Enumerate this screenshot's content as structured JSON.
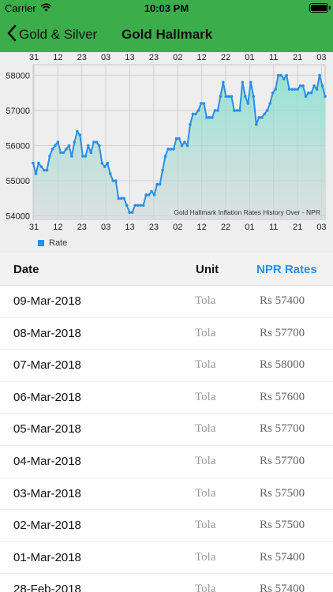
{
  "status": {
    "carrier": "Carrier",
    "time": "10:03 PM"
  },
  "nav": {
    "back_label": "Gold & Silver",
    "title": "Gold Hallmark"
  },
  "chart_data": {
    "type": "line",
    "title": "Gold Hallmark Inflation Rates History Over - NPR",
    "x_tick_labels": [
      "31",
      "12",
      "23",
      "03",
      "13",
      "23",
      "02",
      "12",
      "22",
      "01",
      "11",
      "21",
      "03"
    ],
    "ylim": [
      53900,
      58300
    ],
    "y_ticks": [
      54000,
      55000,
      56000,
      57000,
      58000
    ],
    "grid": true,
    "legend_position": "bottom-left",
    "series": [
      {
        "name": "Rate",
        "color": "#2a8ee8",
        "fill": true,
        "values": [
          55500,
          55200,
          55500,
          55400,
          55300,
          55300,
          55700,
          55900,
          56000,
          56100,
          55800,
          55800,
          55900,
          56000,
          55700,
          56100,
          56400,
          56300,
          55700,
          55700,
          56000,
          55800,
          56100,
          56100,
          56000,
          55500,
          55400,
          55500,
          55200,
          55000,
          55000,
          54500,
          54500,
          54500,
          54300,
          54100,
          54100,
          54300,
          54300,
          54300,
          54300,
          54600,
          54600,
          54700,
          54600,
          54900,
          54900,
          55300,
          55700,
          55900,
          55900,
          55900,
          56200,
          56200,
          56000,
          56100,
          56000,
          56600,
          56900,
          56900,
          57000,
          57200,
          57200,
          56800,
          56800,
          56800,
          57000,
          57000,
          57400,
          57800,
          57400,
          57400,
          57400,
          57000,
          57000,
          57000,
          57800,
          57400,
          57200,
          57800,
          57400,
          56600,
          56800,
          56800,
          56900,
          57000,
          57200,
          57500,
          57600,
          58000,
          58000,
          57900,
          58000,
          57600,
          57600,
          57600,
          57600,
          57700,
          57700,
          57400,
          57500,
          57500,
          57700,
          57600,
          58000,
          57700,
          57400
        ]
      }
    ]
  },
  "table": {
    "headers": {
      "date": "Date",
      "unit": "Unit",
      "rate": "NPR Rates"
    },
    "rows": [
      {
        "date": "09-Mar-2018",
        "unit": "Tola",
        "rate": "Rs 57400"
      },
      {
        "date": "08-Mar-2018",
        "unit": "Tola",
        "rate": "Rs 57700"
      },
      {
        "date": "07-Mar-2018",
        "unit": "Tola",
        "rate": "Rs 58000"
      },
      {
        "date": "06-Mar-2018",
        "unit": "Tola",
        "rate": "Rs 57600"
      },
      {
        "date": "05-Mar-2018",
        "unit": "Tola",
        "rate": "Rs 57700"
      },
      {
        "date": "04-Mar-2018",
        "unit": "Tola",
        "rate": "Rs 57700"
      },
      {
        "date": "03-Mar-2018",
        "unit": "Tola",
        "rate": "Rs 57500"
      },
      {
        "date": "02-Mar-2018",
        "unit": "Tola",
        "rate": "Rs 57500"
      },
      {
        "date": "01-Mar-2018",
        "unit": "Tola",
        "rate": "Rs 57400"
      },
      {
        "date": "28-Feb-2018",
        "unit": "Tola",
        "rate": "Rs 57400"
      }
    ]
  },
  "colors": {
    "nav_green": "#3bad4a",
    "accent_blue": "#2a8ee8",
    "chart_bg": "#eeeeee"
  }
}
